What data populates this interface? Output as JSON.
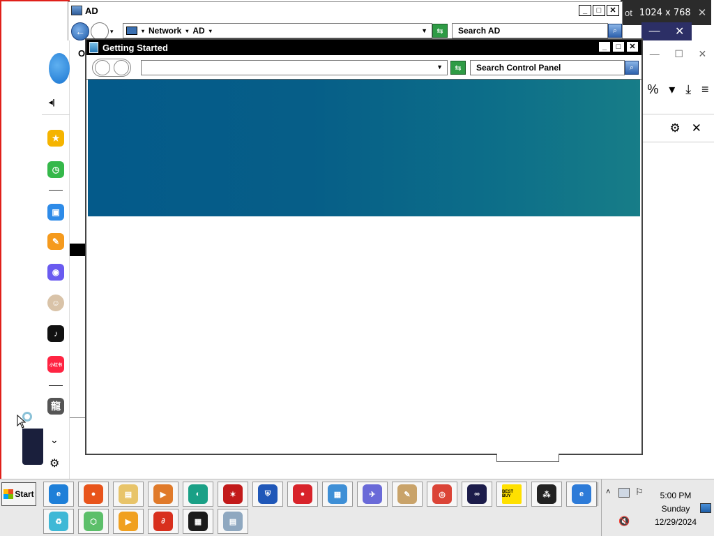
{
  "overlay": {
    "prefix": "ot",
    "dimensions": "1024 x 768",
    "close": "✕"
  },
  "navy_bar": {
    "min": "—",
    "close": "✕"
  },
  "bg_browser": {
    "row1": [
      "—",
      "☐",
      "✕"
    ],
    "row2": [
      "%",
      "▾",
      "⤓",
      "≡"
    ],
    "row3": [
      "⚙",
      "✕"
    ]
  },
  "sidebar": {
    "collapse": "◂|",
    "items": [
      {
        "name": "favorites",
        "glyph": "★",
        "color": "#f5b400"
      },
      {
        "name": "history",
        "glyph": "◷",
        "color": "#35b84a"
      },
      {
        "name": "toolbox",
        "glyph": "▣",
        "color": "#2e8be8"
      },
      {
        "name": "tools",
        "glyph": "✎",
        "color": "#f59a1d"
      },
      {
        "name": "games",
        "glyph": "◉",
        "color": "#6a5bf0"
      },
      {
        "name": "avatar",
        "glyph": "☺",
        "color": "#d9c3a8"
      },
      {
        "name": "tiktok",
        "glyph": "♪",
        "color": "#111111"
      },
      {
        "name": "xiaohongshu",
        "glyph": "小红书",
        "color": "#ff2442"
      },
      {
        "name": "dragon",
        "glyph": "龍",
        "color": "#555555"
      }
    ],
    "chevron": "⌄",
    "settings": "⚙"
  },
  "ad_window": {
    "title": "AD",
    "buttons": {
      "min": "_",
      "max": "□",
      "close": "✕"
    },
    "breadcrumbs": [
      "Network",
      "AD"
    ],
    "search_placeholder": "Search AD",
    "side_letter": "O"
  },
  "cp_window": {
    "title": "Getting Started",
    "buttons": {
      "min": "_",
      "max": "□",
      "close": "✕"
    },
    "address_value": "",
    "search_placeholder": "Search Control Panel"
  },
  "taskbar": {
    "start_label": "Start",
    "row1": [
      {
        "name": "internet-explorer",
        "label": "e",
        "color": "#1e7fd8"
      },
      {
        "name": "firefox",
        "label": "●",
        "color": "#e8541b"
      },
      {
        "name": "file-explorer",
        "label": "▤",
        "color": "#e8c46a"
      },
      {
        "name": "media-player",
        "label": "▶",
        "color": "#e07a2a"
      },
      {
        "name": "teal-app",
        "label": "◐",
        "color": "#1aa086"
      },
      {
        "name": "red-gear-app",
        "label": "✶",
        "color": "#c21a1a"
      },
      {
        "name": "vpn-shield",
        "label": "⛨",
        "color": "#1f57b8"
      },
      {
        "name": "screen-recorder",
        "label": "●",
        "color": "#d8232a"
      },
      {
        "name": "network-app",
        "label": "▦",
        "color": "#3e8fd6"
      },
      {
        "name": "bird-app",
        "label": "✈",
        "color": "#6a6ad8"
      },
      {
        "name": "paint-app",
        "label": "✎",
        "color": "#c9a36a"
      },
      {
        "name": "chrome",
        "label": "◎",
        "color": "#db4437"
      },
      {
        "name": "infinity-app",
        "label": "∞",
        "color": "#1c1c4a"
      },
      {
        "name": "best-buy",
        "label": "BEST BUY",
        "color": "#ffe000"
      },
      {
        "name": "blackberry",
        "label": "⁂",
        "color": "#222222"
      },
      {
        "name": "edge-e",
        "label": "e",
        "color": "#2d7bd8"
      }
    ],
    "row2": [
      {
        "name": "recycle-bin",
        "label": "♻",
        "color": "#3fb8d6"
      },
      {
        "name": "cube-app",
        "label": "⬡",
        "color": "#5cbf6a"
      },
      {
        "name": "play-app",
        "label": "▶",
        "color": "#f0a020"
      },
      {
        "name": "red-swirl-app",
        "label": "∂",
        "color": "#d8301e"
      },
      {
        "name": "grid-app",
        "label": "▦",
        "color": "#1c1c1c"
      },
      {
        "name": "document-app",
        "label": "▤",
        "color": "#8fa8c0"
      }
    ],
    "tray": {
      "up_arrow": "˄",
      "flag": "⚐",
      "volume": "🔇",
      "time": "5:00 PM",
      "day": "Sunday",
      "date": "12/29/2024"
    }
  }
}
